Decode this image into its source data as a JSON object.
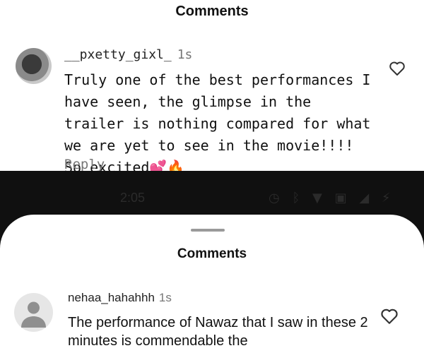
{
  "top_panel": {
    "title": "Comments",
    "comment": {
      "username": "__pxetty_gixl_",
      "time": "1s",
      "text": "Truly one of the best performances I have seen, the glimpse in the trailer is nothing compared for what we are yet to see in the movie!!!! So excited💕🔥",
      "reply_label": "Reply"
    }
  },
  "status_bar": {
    "time": "2:05",
    "icons": [
      "alarm-icon",
      "bluetooth-icon",
      "wifi-icon",
      "hotspot-icon",
      "signal-icon",
      "battery-icon"
    ]
  },
  "bottom_sheet": {
    "title": "Comments",
    "comment": {
      "username": "nehaa_hahahhh",
      "time": "1s",
      "text": "The performance of Nawaz that I saw in these 2 minutes is commendable the"
    }
  }
}
